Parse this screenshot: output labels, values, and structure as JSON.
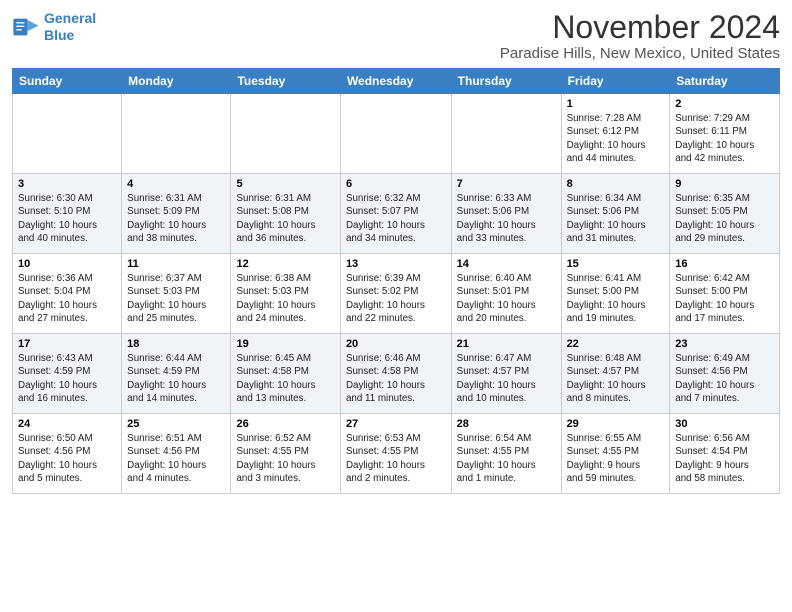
{
  "logo": {
    "line1": "General",
    "line2": "Blue"
  },
  "title": "November 2024",
  "location": "Paradise Hills, New Mexico, United States",
  "weekdays": [
    "Sunday",
    "Monday",
    "Tuesday",
    "Wednesday",
    "Thursday",
    "Friday",
    "Saturday"
  ],
  "weeks": [
    [
      {
        "day": "",
        "info": ""
      },
      {
        "day": "",
        "info": ""
      },
      {
        "day": "",
        "info": ""
      },
      {
        "day": "",
        "info": ""
      },
      {
        "day": "",
        "info": ""
      },
      {
        "day": "1",
        "info": "Sunrise: 7:28 AM\nSunset: 6:12 PM\nDaylight: 10 hours\nand 44 minutes."
      },
      {
        "day": "2",
        "info": "Sunrise: 7:29 AM\nSunset: 6:11 PM\nDaylight: 10 hours\nand 42 minutes."
      }
    ],
    [
      {
        "day": "3",
        "info": "Sunrise: 6:30 AM\nSunset: 5:10 PM\nDaylight: 10 hours\nand 40 minutes."
      },
      {
        "day": "4",
        "info": "Sunrise: 6:31 AM\nSunset: 5:09 PM\nDaylight: 10 hours\nand 38 minutes."
      },
      {
        "day": "5",
        "info": "Sunrise: 6:31 AM\nSunset: 5:08 PM\nDaylight: 10 hours\nand 36 minutes."
      },
      {
        "day": "6",
        "info": "Sunrise: 6:32 AM\nSunset: 5:07 PM\nDaylight: 10 hours\nand 34 minutes."
      },
      {
        "day": "7",
        "info": "Sunrise: 6:33 AM\nSunset: 5:06 PM\nDaylight: 10 hours\nand 33 minutes."
      },
      {
        "day": "8",
        "info": "Sunrise: 6:34 AM\nSunset: 5:06 PM\nDaylight: 10 hours\nand 31 minutes."
      },
      {
        "day": "9",
        "info": "Sunrise: 6:35 AM\nSunset: 5:05 PM\nDaylight: 10 hours\nand 29 minutes."
      }
    ],
    [
      {
        "day": "10",
        "info": "Sunrise: 6:36 AM\nSunset: 5:04 PM\nDaylight: 10 hours\nand 27 minutes."
      },
      {
        "day": "11",
        "info": "Sunrise: 6:37 AM\nSunset: 5:03 PM\nDaylight: 10 hours\nand 25 minutes."
      },
      {
        "day": "12",
        "info": "Sunrise: 6:38 AM\nSunset: 5:03 PM\nDaylight: 10 hours\nand 24 minutes."
      },
      {
        "day": "13",
        "info": "Sunrise: 6:39 AM\nSunset: 5:02 PM\nDaylight: 10 hours\nand 22 minutes."
      },
      {
        "day": "14",
        "info": "Sunrise: 6:40 AM\nSunset: 5:01 PM\nDaylight: 10 hours\nand 20 minutes."
      },
      {
        "day": "15",
        "info": "Sunrise: 6:41 AM\nSunset: 5:00 PM\nDaylight: 10 hours\nand 19 minutes."
      },
      {
        "day": "16",
        "info": "Sunrise: 6:42 AM\nSunset: 5:00 PM\nDaylight: 10 hours\nand 17 minutes."
      }
    ],
    [
      {
        "day": "17",
        "info": "Sunrise: 6:43 AM\nSunset: 4:59 PM\nDaylight: 10 hours\nand 16 minutes."
      },
      {
        "day": "18",
        "info": "Sunrise: 6:44 AM\nSunset: 4:59 PM\nDaylight: 10 hours\nand 14 minutes."
      },
      {
        "day": "19",
        "info": "Sunrise: 6:45 AM\nSunset: 4:58 PM\nDaylight: 10 hours\nand 13 minutes."
      },
      {
        "day": "20",
        "info": "Sunrise: 6:46 AM\nSunset: 4:58 PM\nDaylight: 10 hours\nand 11 minutes."
      },
      {
        "day": "21",
        "info": "Sunrise: 6:47 AM\nSunset: 4:57 PM\nDaylight: 10 hours\nand 10 minutes."
      },
      {
        "day": "22",
        "info": "Sunrise: 6:48 AM\nSunset: 4:57 PM\nDaylight: 10 hours\nand 8 minutes."
      },
      {
        "day": "23",
        "info": "Sunrise: 6:49 AM\nSunset: 4:56 PM\nDaylight: 10 hours\nand 7 minutes."
      }
    ],
    [
      {
        "day": "24",
        "info": "Sunrise: 6:50 AM\nSunset: 4:56 PM\nDaylight: 10 hours\nand 5 minutes."
      },
      {
        "day": "25",
        "info": "Sunrise: 6:51 AM\nSunset: 4:56 PM\nDaylight: 10 hours\nand 4 minutes."
      },
      {
        "day": "26",
        "info": "Sunrise: 6:52 AM\nSunset: 4:55 PM\nDaylight: 10 hours\nand 3 minutes."
      },
      {
        "day": "27",
        "info": "Sunrise: 6:53 AM\nSunset: 4:55 PM\nDaylight: 10 hours\nand 2 minutes."
      },
      {
        "day": "28",
        "info": "Sunrise: 6:54 AM\nSunset: 4:55 PM\nDaylight: 10 hours\nand 1 minute."
      },
      {
        "day": "29",
        "info": "Sunrise: 6:55 AM\nSunset: 4:55 PM\nDaylight: 9 hours\nand 59 minutes."
      },
      {
        "day": "30",
        "info": "Sunrise: 6:56 AM\nSunset: 4:54 PM\nDaylight: 9 hours\nand 58 minutes."
      }
    ]
  ]
}
